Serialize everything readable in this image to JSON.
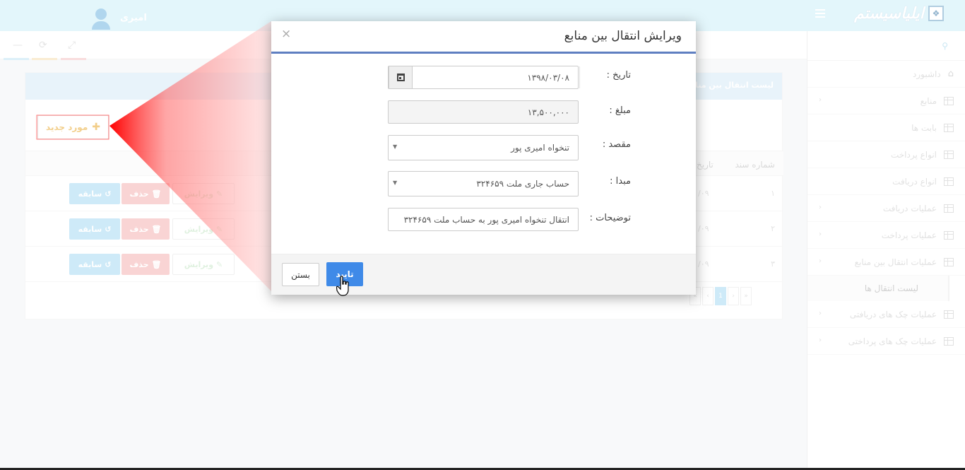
{
  "header": {
    "brand": "ایلیاسیستم",
    "user_name": "امیری"
  },
  "sidebar": {
    "items": [
      {
        "label": "داشبورد",
        "icon": "home-icon",
        "chevron": false
      },
      {
        "label": "منابع",
        "icon": "grid-icon",
        "chevron": true
      },
      {
        "label": "بابت ها",
        "icon": "grid-icon",
        "chevron": false
      },
      {
        "label": "انواع پرداخت",
        "icon": "grid-icon",
        "chevron": false
      },
      {
        "label": "انواع دریافت",
        "icon": "grid-icon",
        "chevron": false
      },
      {
        "label": "عملیات دریافت",
        "icon": "grid-icon",
        "chevron": true
      },
      {
        "label": "عملیات پرداخت",
        "icon": "grid-icon",
        "chevron": true
      },
      {
        "label": "عملیات انتقال بین منابع",
        "icon": "grid-icon",
        "chevron": true
      }
    ],
    "sub_item": "لیست انتقال ها",
    "items_after": [
      {
        "label": "عملیات چک های دریافتی",
        "icon": "grid-icon",
        "chevron": true
      },
      {
        "label": "عملیات چک های پرداختی",
        "icon": "grid-icon",
        "chevron": true
      }
    ]
  },
  "panel": {
    "title": "لیست انتقال بین منابع",
    "new_button": "مورد جدید",
    "columns": {
      "doc_number": "شماره سند",
      "date": "تاریخ"
    },
    "rows": [
      {
        "num": "۱",
        "date": "/۰۹"
      },
      {
        "num": "۲",
        "date": "/۰۹"
      },
      {
        "num": "۳",
        "date": "/۰۹"
      }
    ],
    "row_buttons": {
      "edit": "ویرایش",
      "delete": "حذف",
      "history": "سابقه"
    },
    "pager": [
      "«",
      "‹",
      "1",
      "›",
      "»"
    ]
  },
  "modal": {
    "title": "ویرایش انتقال بین منابع",
    "close_glyph": "×",
    "fields": {
      "date_label": "تاریخ :",
      "date_value": "۱۳۹۸/۰۳/۰۸",
      "amount_label": "مبلغ :",
      "amount_value": "۱۳,۵۰۰,۰۰۰",
      "dest_label": "مقصد :",
      "dest_value": "تنخواه امیری پور",
      "source_label": "مبدا :",
      "source_value": "حساب جاری ملت ۳۲۴۶۵۹",
      "desc_label": "توضیحات :",
      "desc_value": "انتقال تنخواه امیری پور به حساب ملت ۳۲۴۶۵۹"
    },
    "ok_button": "تایید",
    "close_button": "بستن"
  },
  "colors": {
    "header_bg": "#cdeef8",
    "primary": "#3f8ae8",
    "modal_accent": "#5f7fc1",
    "spotlight": "#ff0000"
  }
}
